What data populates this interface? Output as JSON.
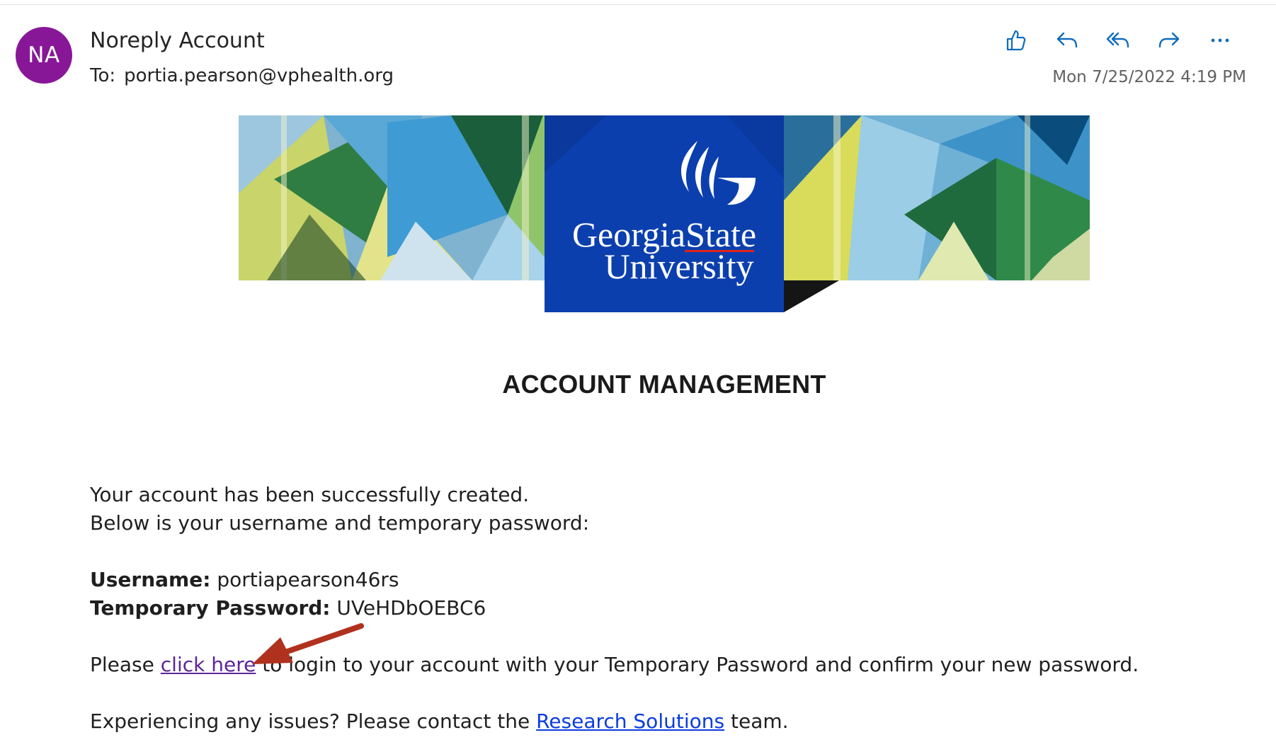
{
  "header": {
    "avatar_initials": "NA",
    "avatar_color": "#881798",
    "sender_name": "Noreply Account",
    "to_label": "To:",
    "to_address": "portia.pearson@vphealth.org",
    "timestamp": "Mon 7/25/2022 4:19 PM",
    "toolbar": [
      {
        "name": "like",
        "icon": "thumbs-up-icon"
      },
      {
        "name": "reply",
        "icon": "reply-icon"
      },
      {
        "name": "reply-all",
        "icon": "reply-all-icon"
      },
      {
        "name": "forward",
        "icon": "forward-icon"
      },
      {
        "name": "more",
        "icon": "more-horizontal-icon"
      }
    ],
    "accent_color": "#0f6cbd"
  },
  "banner": {
    "logo_line1": "GeorgiaState",
    "logo_line2": "University",
    "logo_color": "#0c3fae"
  },
  "email": {
    "heading": "ACCOUNT MANAGEMENT",
    "line1": "Your account has been successfully created.",
    "line2": "Below is your username and temporary password:",
    "username_label": "Username:",
    "username_value": "portiapearson46rs",
    "password_label": "Temporary Password:",
    "password_value": "UVeHDbOEBC6",
    "login_prefix": "Please",
    "login_link": "click here",
    "login_suffix": "to login to your account with your Temporary Password and confirm your new password.",
    "issues_prefix": "Experiencing any issues? Please contact the",
    "issues_link": "Research Solutions",
    "issues_suffix": "team."
  },
  "annotation": {
    "arrow_color": "#b0321e"
  }
}
